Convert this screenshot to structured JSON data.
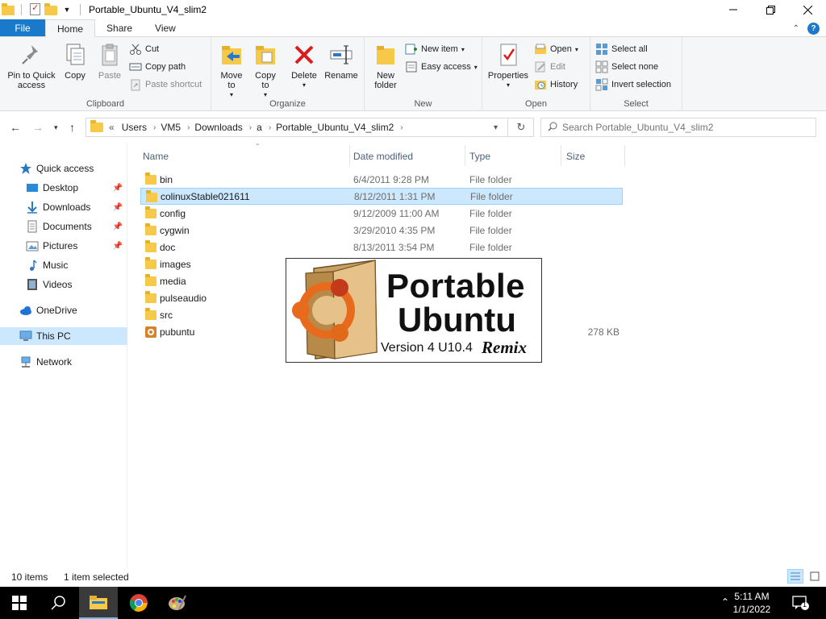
{
  "window": {
    "title": "Portable_Ubuntu_V4_slim2",
    "minimize_icon": "minimize-icon",
    "maximize_icon": "restore-icon",
    "close_icon": "close-icon"
  },
  "ribbon_tabs": {
    "file": "File",
    "home": "Home",
    "share": "Share",
    "view": "View"
  },
  "ribbon": {
    "clipboard": {
      "label": "Clipboard",
      "pin": "Pin to Quick access",
      "copy": "Copy",
      "paste": "Paste",
      "cut": "Cut",
      "copy_path": "Copy path",
      "paste_shortcut": "Paste shortcut"
    },
    "organize": {
      "label": "Organize",
      "move_to": "Move to",
      "copy_to": "Copy to",
      "delete": "Delete",
      "rename": "Rename"
    },
    "new": {
      "label": "New",
      "new_folder": "New folder",
      "new_item": "New item",
      "easy_access": "Easy access"
    },
    "open": {
      "label": "Open",
      "properties": "Properties",
      "open": "Open",
      "edit": "Edit",
      "history": "History"
    },
    "select": {
      "label": "Select",
      "select_all": "Select all",
      "select_none": "Select none",
      "invert_selection": "Invert selection"
    }
  },
  "address": {
    "overflow": "«",
    "crumbs": [
      "Users",
      "VM5",
      "Downloads",
      "a",
      "Portable_Ubuntu_V4_slim2"
    ],
    "search_placeholder": "Search Portable_Ubuntu_V4_slim2"
  },
  "nav": {
    "quick_access": "Quick access",
    "desktop": "Desktop",
    "downloads": "Downloads",
    "documents": "Documents",
    "pictures": "Pictures",
    "music": "Music",
    "videos": "Videos",
    "onedrive": "OneDrive",
    "this_pc": "This PC",
    "network": "Network"
  },
  "columns": {
    "name": "Name",
    "date": "Date modified",
    "type": "Type",
    "size": "Size"
  },
  "files": [
    {
      "name": "bin",
      "date": "6/4/2011 9:28 PM",
      "type": "File folder",
      "size": ""
    },
    {
      "name": "colinuxStable021611",
      "date": "8/12/2011 1:31 PM",
      "type": "File folder",
      "size": ""
    },
    {
      "name": "config",
      "date": "9/12/2009 11:00 AM",
      "type": "File folder",
      "size": ""
    },
    {
      "name": "cygwin",
      "date": "3/29/2010 4:35 PM",
      "type": "File folder",
      "size": ""
    },
    {
      "name": "doc",
      "date": "8/13/2011 3:54 PM",
      "type": "File folder",
      "size": ""
    },
    {
      "name": "images",
      "date": "",
      "type": "",
      "size": ""
    },
    {
      "name": "media",
      "date": "",
      "type": "",
      "size": ""
    },
    {
      "name": "pulseaudio",
      "date": "",
      "type": "",
      "size": ""
    },
    {
      "name": "src",
      "date": "",
      "type": "",
      "size": ""
    },
    {
      "name": "pubuntu",
      "date": "",
      "type": "",
      "size": "278 KB"
    }
  ],
  "preview": {
    "line1": "Portable",
    "line2": "Ubuntu",
    "version": "Version 4  U10.4",
    "remix": "Remix"
  },
  "status": {
    "items": "10 items",
    "selected": "1 item selected"
  },
  "taskbar": {
    "time": "5:11 AM",
    "date": "1/1/2022",
    "notification_count": "1"
  },
  "colors": {
    "accent": "#1979ca",
    "selection": "#cce8ff",
    "folder": "#f7c948"
  }
}
